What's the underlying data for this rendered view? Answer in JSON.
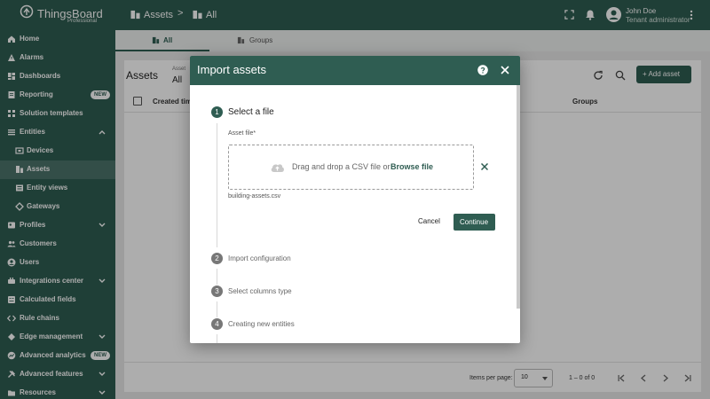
{
  "topbar": {
    "brand": "ThingsBoard",
    "brand_sub": "Professional",
    "breadcrumb": [
      "Assets",
      "All"
    ],
    "breadcrumb_sep": ">",
    "user_name": "John Doe",
    "user_role": "Tenant administrator",
    "icons": [
      "fullscreen-icon",
      "notifications-icon",
      "account-icon",
      "more-vert-icon"
    ]
  },
  "sidebar": {
    "items": [
      {
        "label": "Home",
        "icon": "home-icon"
      },
      {
        "label": "Alarms",
        "icon": "alarm-icon"
      },
      {
        "label": "Dashboards",
        "icon": "dashboards-icon"
      },
      {
        "label": "Reporting",
        "icon": "reporting-icon",
        "badge": "NEW"
      },
      {
        "label": "Solution templates",
        "icon": "templates-icon"
      },
      {
        "label": "Entities",
        "icon": "entities-icon",
        "expanded": true
      },
      {
        "label": "Devices",
        "icon": "devices-icon"
      },
      {
        "label": "Assets",
        "icon": "assets-icon",
        "active": true
      },
      {
        "label": "Entity views",
        "icon": "entity-views-icon"
      },
      {
        "label": "Gateways",
        "icon": "gateways-icon"
      },
      {
        "label": "Profiles",
        "icon": "profiles-icon"
      },
      {
        "label": "Customers",
        "icon": "customers-icon"
      },
      {
        "label": "Users",
        "icon": "users-icon"
      },
      {
        "label": "Integrations center",
        "icon": "integrations-icon"
      },
      {
        "label": "Calculated fields",
        "icon": "calculated-fields-icon"
      },
      {
        "label": "Rule chains",
        "icon": "rule-chains-icon"
      },
      {
        "label": "Edge management",
        "icon": "edge-icon"
      },
      {
        "label": "Advanced analytics",
        "icon": "analytics-icon",
        "badge": "NEW"
      },
      {
        "label": "Advanced features",
        "icon": "advanced-features-icon"
      },
      {
        "label": "Resources",
        "icon": "resources-icon"
      }
    ]
  },
  "main": {
    "tabs": [
      "All",
      "Groups"
    ],
    "card_title": "Assets",
    "filter_label": "Asset",
    "filter_value": "All",
    "add_button": "+ Add asset",
    "columns": {
      "created": "Created time",
      "groups": "Groups"
    },
    "footer": {
      "items_per_page_label": "Items per page:",
      "items_per_page": "10",
      "range": "1 – 0 of 0"
    }
  },
  "dialog": {
    "title": "Import assets",
    "steps": [
      {
        "num": "1",
        "title": "Select a file"
      },
      {
        "num": "2",
        "title": "Import configuration"
      },
      {
        "num": "3",
        "title": "Select columns type"
      },
      {
        "num": "4",
        "title": "Creating new entities"
      }
    ],
    "field_label": "Asset file*",
    "dropzone_text": "Drag and drop a CSV file or",
    "browse_label": "Browse file",
    "file_name": "building-assets.csv",
    "cancel_label": "Cancel",
    "continue_label": "Continue"
  },
  "colors": {
    "brand": "#2f5d52",
    "scrim": "rgba(0,0,0,0.32)"
  }
}
